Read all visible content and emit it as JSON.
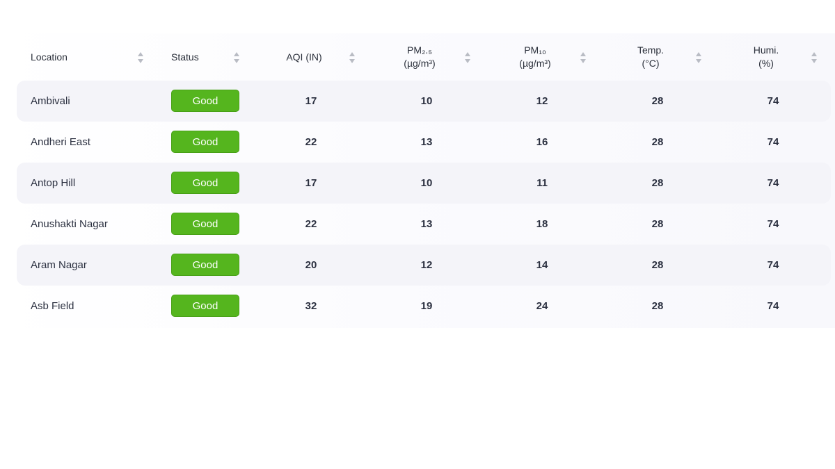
{
  "table": {
    "columns": [
      {
        "key": "location",
        "label": "Location",
        "sort_icon": "sort-arrows-icon"
      },
      {
        "key": "status",
        "label": "Status",
        "sort_icon": "sort-arrows-icon"
      },
      {
        "key": "aqi",
        "label": "AQI (IN)",
        "sort_icon": "sort-arrows-icon"
      },
      {
        "key": "pm25",
        "label_line1": "PM₂.₅",
        "label_line2": "(µg/m³)",
        "sort_icon": "sort-arrows-icon"
      },
      {
        "key": "pm10",
        "label_line1": "PM₁₀",
        "label_line2": "(µg/m³)",
        "sort_icon": "sort-arrows-icon"
      },
      {
        "key": "temp",
        "label_line1": "Temp.",
        "label_line2": "(°C)",
        "sort_icon": "sort-arrows-icon"
      },
      {
        "key": "humi",
        "label_line1": "Humi.",
        "label_line2": "(%)",
        "sort_icon": "sort-arrows-icon"
      }
    ],
    "rows": [
      {
        "location": "Ambivali",
        "status": "Good",
        "aqi": "17",
        "pm25": "10",
        "pm10": "12",
        "temp": "28",
        "humi": "74"
      },
      {
        "location": "Andheri East",
        "status": "Good",
        "aqi": "22",
        "pm25": "13",
        "pm10": "16",
        "temp": "28",
        "humi": "74"
      },
      {
        "location": "Antop Hill",
        "status": "Good",
        "aqi": "17",
        "pm25": "10",
        "pm10": "11",
        "temp": "28",
        "humi": "74"
      },
      {
        "location": "Anushakti Nagar",
        "status": "Good",
        "aqi": "22",
        "pm25": "13",
        "pm10": "18",
        "temp": "28",
        "humi": "74"
      },
      {
        "location": "Aram Nagar",
        "status": "Good",
        "aqi": "20",
        "pm25": "12",
        "pm10": "14",
        "temp": "28",
        "humi": "74"
      },
      {
        "location": "Asb Field",
        "status": "Good",
        "aqi": "32",
        "pm25": "19",
        "pm10": "24",
        "temp": "28",
        "humi": "74"
      }
    ]
  },
  "colors": {
    "status_good": "#55b51e",
    "row_shade": "#f4f4f9",
    "sort_arrow": "#b9bcc4"
  }
}
